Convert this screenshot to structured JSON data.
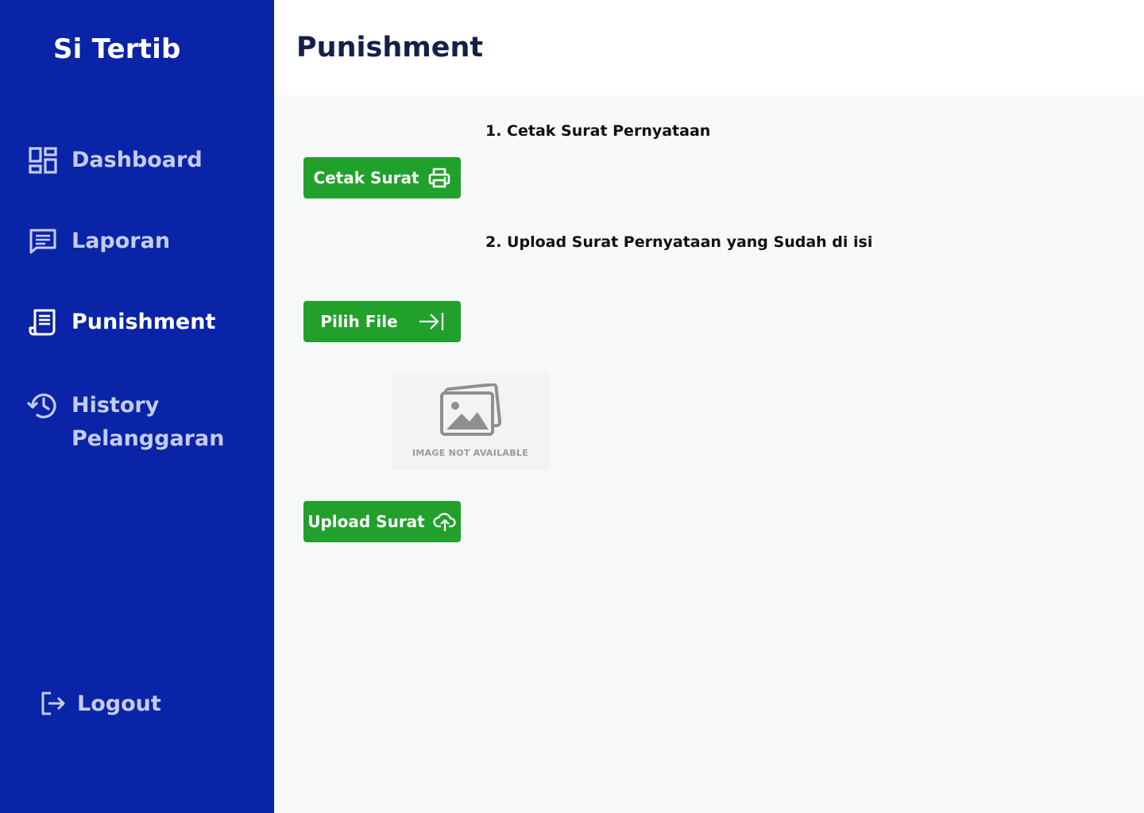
{
  "sidebar": {
    "brand": "Si Tertib",
    "items": [
      {
        "label": "Dashboard",
        "icon": "dashboard-icon"
      },
      {
        "label": "Laporan",
        "icon": "chat-icon"
      },
      {
        "label": "Punishment",
        "icon": "document-icon",
        "active": true
      },
      {
        "label": "History Pelanggaran",
        "icon": "history-icon"
      }
    ],
    "logout": "Logout"
  },
  "header": {
    "title": "Punishment"
  },
  "main": {
    "step1": "1. Cetak Surat Pernyataan",
    "step2": "2. Upload Surat Pernyataan yang Sudah di isi",
    "cetak_button": "Cetak Surat",
    "pilih_button": "Pilih File",
    "upload_button": "Upload Surat",
    "preview_caption": "IMAGE NOT AVAILABLE"
  },
  "colors": {
    "sidebar": "#0a24a7",
    "accent_green": "#21a12b",
    "title": "#15204a"
  }
}
